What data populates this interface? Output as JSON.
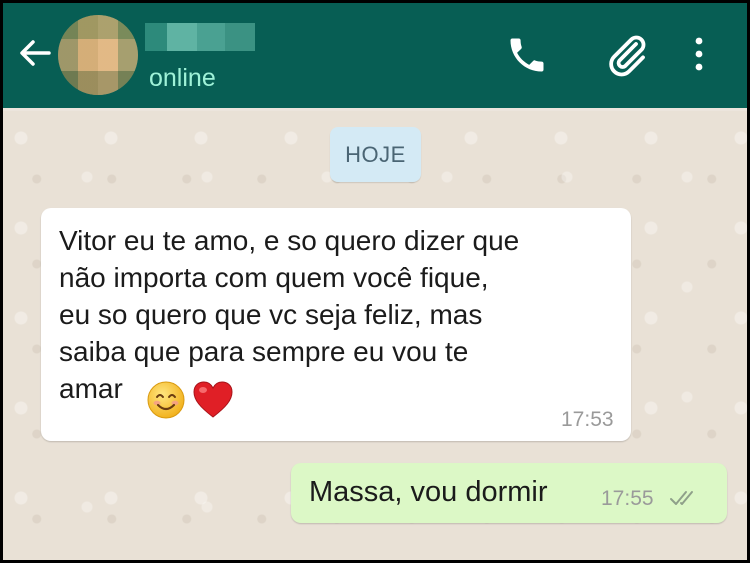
{
  "header": {
    "status": "online",
    "contact_name_hidden": true
  },
  "chat": {
    "date_chip": "HOJE",
    "messages": [
      {
        "direction": "incoming",
        "lines": [
          "Vitor eu te amo, e so quero dizer que",
          "não importa com quem você fique,",
          "eu so quero que vc seja feliz, mas",
          "saiba que para sempre eu vou te",
          "amar"
        ],
        "emojis": [
          "smiling-face-emoji",
          "red-heart-emoji"
        ],
        "time": "17:53"
      },
      {
        "direction": "outgoing",
        "text": "Massa, vou dormir",
        "time": "17:55",
        "receipt": "double-check-delivered"
      }
    ]
  },
  "colors": {
    "header": "#075e54",
    "status_text": "#9ff2d8",
    "incoming_bubble": "#ffffff",
    "outgoing_bubble": "#dcf8c6",
    "date_chip": "#d4eaf5",
    "wallpaper": "#e9e1d6"
  }
}
